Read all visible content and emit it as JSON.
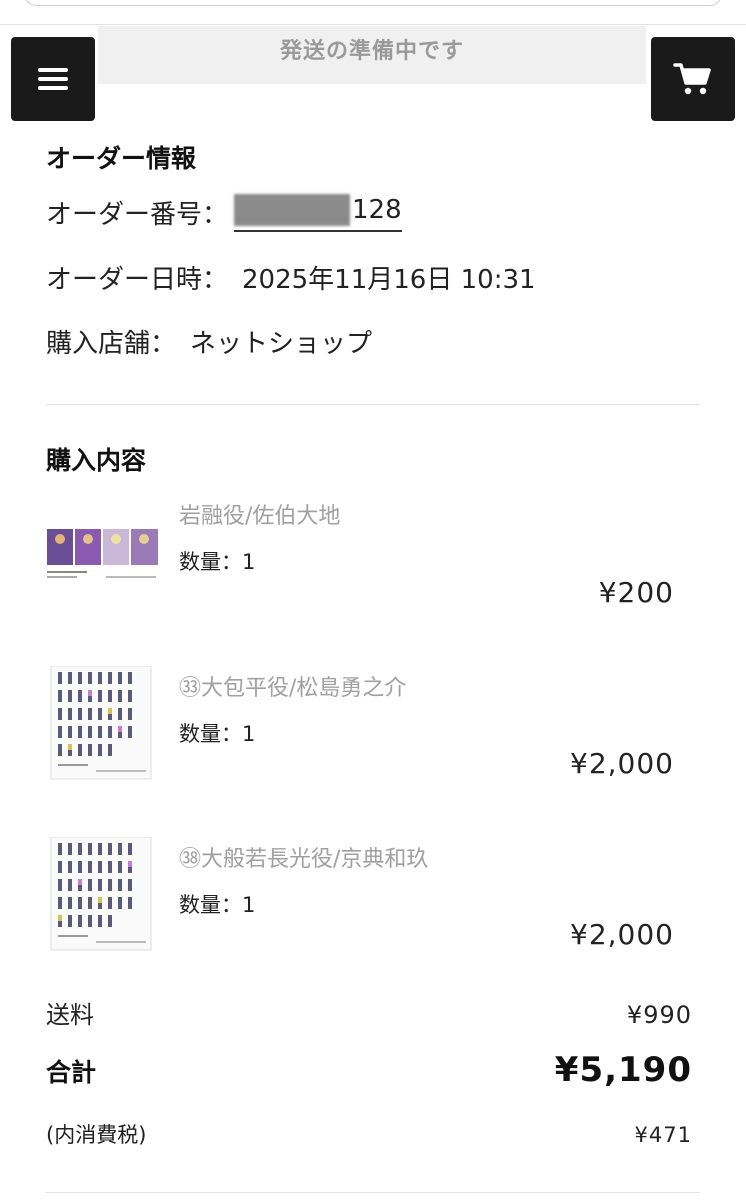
{
  "status_banner": "発送の準備中です",
  "order_info": {
    "title": "オーダー情報",
    "order_number_label": "オーダー番号：",
    "order_number_suffix": "128",
    "order_date_label": "オーダー日時：",
    "order_date_value": "2025年11月16日 10:31",
    "store_label": "購入店舗：",
    "store_value": "ネットショップ"
  },
  "purchase": {
    "title": "購入内容",
    "items": [
      {
        "name": "岩融役/佐伯大地",
        "qty": "数量：1",
        "price": "¥200"
      },
      {
        "name": "㉝大包平役/松島勇之介",
        "qty": "数量：1",
        "price": "¥2,000"
      },
      {
        "name": "㊳大般若長光役/京典和玖",
        "qty": "数量：1",
        "price": "¥2,000"
      }
    ]
  },
  "totals": {
    "shipping_label": "送料",
    "shipping_value": "¥990",
    "total_label": "合計",
    "total_value": "¥5,190",
    "tax_label": "(内消費税)",
    "tax_value": "¥471"
  },
  "icons": {
    "menu": "hamburger-menu-icon",
    "cart": "shopping-cart-icon"
  },
  "colors": {
    "button_bg": "#1a1a1a",
    "muted_text": "#a0a0a0",
    "banner_bg": "#f0f0f0"
  }
}
